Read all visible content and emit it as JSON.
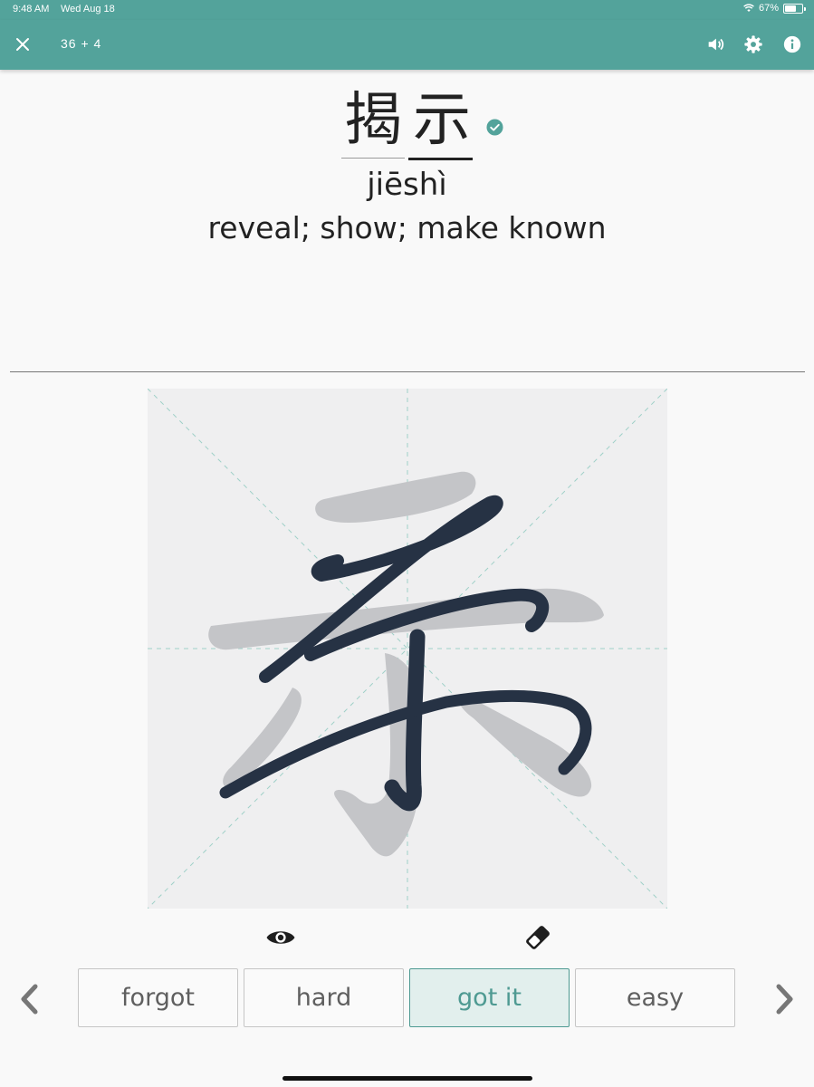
{
  "status_bar": {
    "time": "9:48 AM",
    "date": "Wed Aug 18",
    "battery": "67%"
  },
  "app_bar": {
    "progress": "36 + 4",
    "icons": [
      "close-icon",
      "volume-icon",
      "gear-icon",
      "info-icon"
    ]
  },
  "word": {
    "characters": [
      "揭",
      "示"
    ],
    "pinyin": "jiēshì",
    "meaning": "reveal; show; make known",
    "status_icon": "check-circle-icon"
  },
  "writing_canvas": {
    "hint_character": "示"
  },
  "tools": {
    "reveal_icon": "eye-icon",
    "eraser_icon": "eraser-icon"
  },
  "ratings": [
    {
      "label": "forgot"
    },
    {
      "label": "hard"
    },
    {
      "label": "got it",
      "selected": true
    },
    {
      "label": "easy"
    }
  ],
  "navigation": {
    "prev_icon": "chevron-left-icon",
    "next_icon": "chevron-right-icon"
  },
  "colors": {
    "accent": "#53a39b",
    "ink": "#263244",
    "hint": "#c4c5c8",
    "canvas": "#efeff0"
  }
}
